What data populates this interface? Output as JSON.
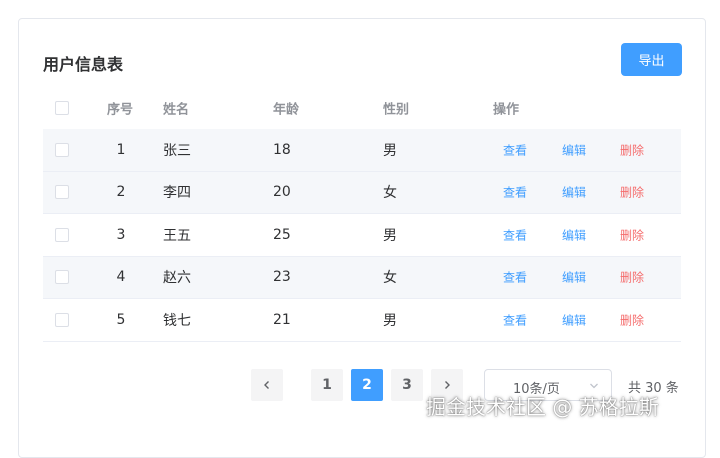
{
  "card": {
    "title": "用户信息表",
    "export_label": "导出"
  },
  "table": {
    "columns": [
      "序号",
      "姓名",
      "年龄",
      "性别",
      "操作"
    ],
    "actions": {
      "view": "查看",
      "edit": "编辑",
      "delete": "删除"
    },
    "rows": [
      {
        "index": "1",
        "name": "张三",
        "age": "18",
        "gender": "男"
      },
      {
        "index": "2",
        "name": "李四",
        "age": "20",
        "gender": "女"
      },
      {
        "index": "3",
        "name": "王五",
        "age": "25",
        "gender": "男"
      },
      {
        "index": "4",
        "name": "赵六",
        "age": "23",
        "gender": "女"
      },
      {
        "index": "5",
        "name": "钱七",
        "age": "21",
        "gender": "男"
      }
    ]
  },
  "pagination": {
    "pages": [
      "1",
      "2",
      "3"
    ],
    "current_page": "2",
    "page_size": "10条/页",
    "total": "共 30 条"
  },
  "watermark": "掘金技术社区 @ 苏格拉斯",
  "colors": {
    "primary": "#409eff",
    "danger": "#f56c6c",
    "stripe": "#f5f7fa"
  }
}
